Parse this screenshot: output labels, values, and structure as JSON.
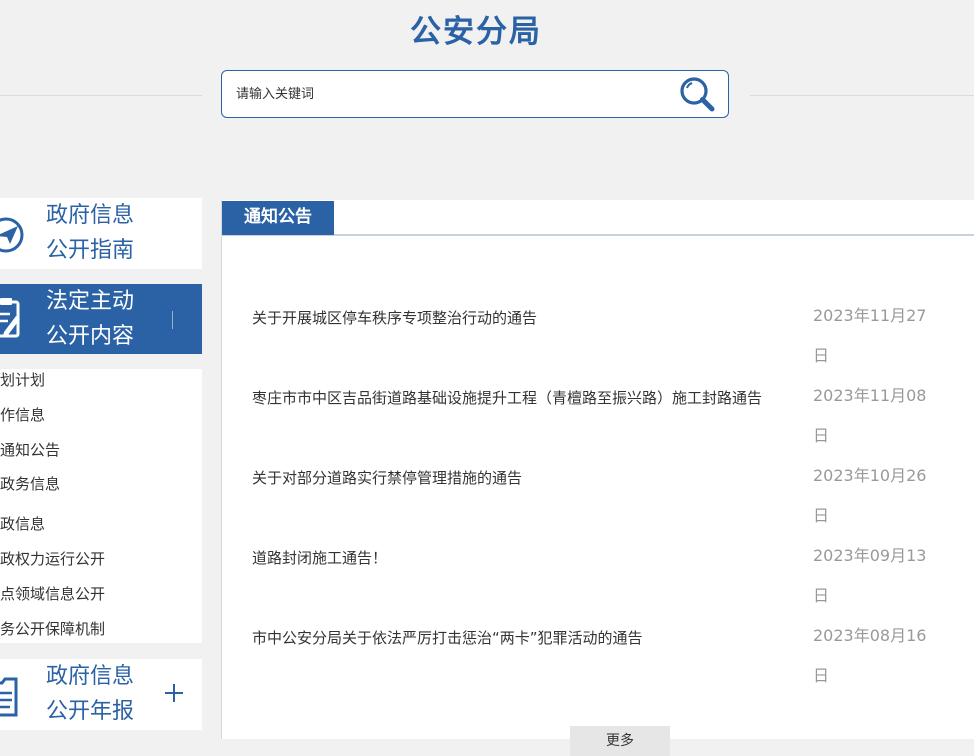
{
  "header": {
    "title": "公安分局",
    "search": {
      "placeholder": "请输入关键词",
      "value": ""
    }
  },
  "sidebar": {
    "guide": {
      "line1": "政府信息",
      "line2": "公开指南"
    },
    "active": {
      "line1": "法定主动",
      "line2": "公开内容"
    },
    "submenu": [
      "划计划",
      "作信息",
      "通知公告",
      "政务信息",
      "政信息",
      "政权力运行公开",
      "点领域信息公开",
      "务公开保障机制"
    ],
    "report": {
      "line1": "政府信息",
      "line2": "公开年报"
    }
  },
  "panel": {
    "tab": "通知公告",
    "items": [
      {
        "title": "关于开展城区停车秩序专项整治行动的通告",
        "date": "2023年11月27日"
      },
      {
        "title": "枣庄市市中区吉品街道路基础设施提升工程（青檀路至振兴路）施工封路通告",
        "date": "2023年11月08日"
      },
      {
        "title": "关于对部分道路实行禁停管理措施的通告",
        "date": "2023年10月26日"
      },
      {
        "title": "道路封闭施工通告！",
        "date": "2023年09月13日"
      },
      {
        "title": "市中公安分局关于依法严厉打击惩治“两卡”犯罪活动的通告",
        "date": "2023年08月16日"
      }
    ],
    "more": "更多"
  },
  "colors": {
    "brand": "#2a62a5",
    "date": "#999999",
    "background": "#f1f1f1"
  },
  "icons": [
    "search-icon",
    "paper-plane-icon",
    "clipboard-edit-icon",
    "folder-document-icon",
    "plus-icon"
  ]
}
